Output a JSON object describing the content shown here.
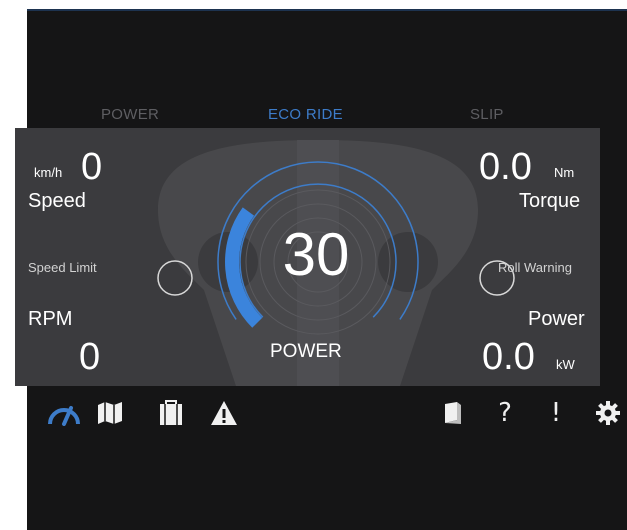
{
  "modes": {
    "power": "POWER",
    "eco_ride": "ECO RIDE",
    "slip": "SLIP",
    "active": "eco_ride"
  },
  "speed": {
    "value": "0",
    "unit": "km/h",
    "label": "Speed"
  },
  "torque": {
    "value": "0.0",
    "unit": "Nm",
    "label": "Torque"
  },
  "rpm": {
    "value": "0",
    "label": "RPM"
  },
  "power": {
    "value": "0.0",
    "unit": "kW",
    "label": "Power"
  },
  "speed_limit": {
    "label": "Speed Limit"
  },
  "roll_warning": {
    "label": "Roll Warning"
  },
  "gauge": {
    "value": "30",
    "label": "POWER",
    "fill_fraction": 0.3
  },
  "toolbar": {
    "left_icons": [
      "gauge-icon",
      "map-icon",
      "clipboard-icon",
      "warning-icon"
    ],
    "right_icons": [
      "book-icon",
      "help-icon",
      "alert-icon",
      "settings-icon"
    ],
    "help_glyph": "?",
    "alert_glyph": "!"
  },
  "colors": {
    "background": "#151516",
    "panel": "#3b3b3e",
    "accent_blue": "#3d7cc9",
    "inactive_text": "#5e5e62",
    "text": "#ffffff"
  }
}
